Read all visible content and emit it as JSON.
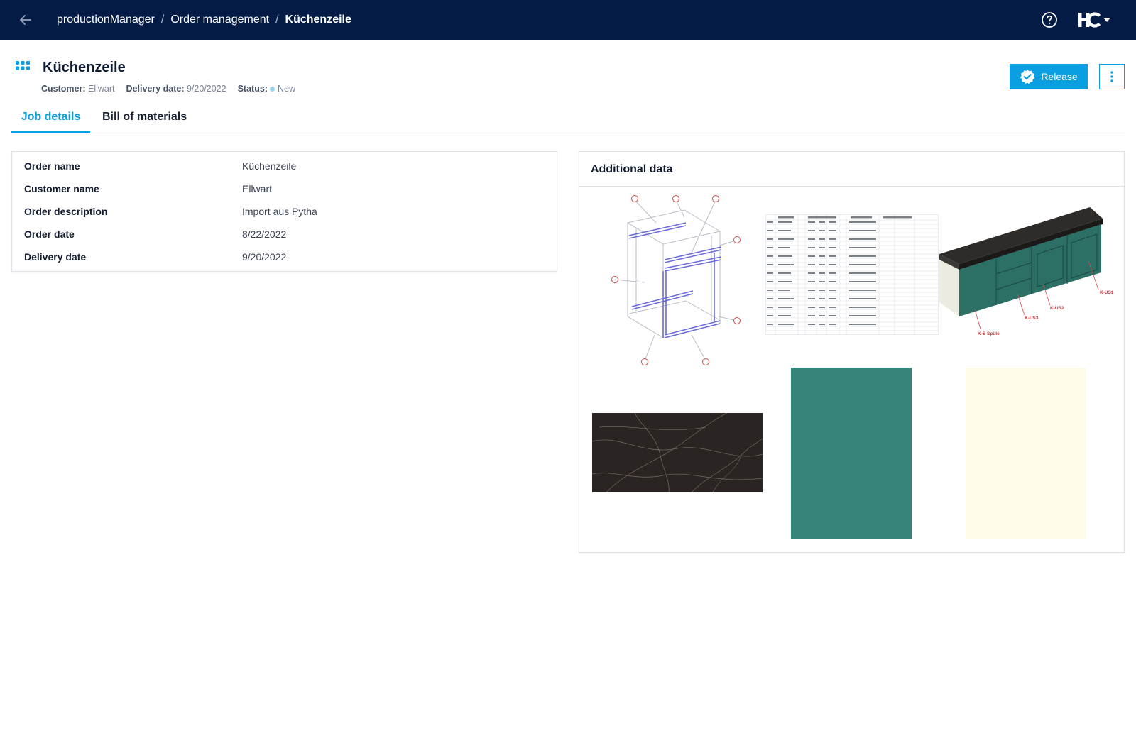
{
  "topbar": {
    "breadcrumbs": [
      "productionManager",
      "Order management",
      "Küchenzeile"
    ],
    "brand_logo_text": "HC"
  },
  "job": {
    "title": "Küchenzeile",
    "customer_label": "Customer:",
    "customer_value": "Ellwart",
    "delivery_label": "Delivery date:",
    "delivery_value": "9/20/2022",
    "status_label": "Status:",
    "status_value": "New",
    "status_color": "#9ad3ea"
  },
  "actions": {
    "release_label": "Release"
  },
  "tabs": [
    {
      "label": "Job details",
      "active": true
    },
    {
      "label": "Bill of materials",
      "active": false
    }
  ],
  "details": [
    {
      "label": "Order name",
      "value": "Küchenzeile"
    },
    {
      "label": "Customer name",
      "value": "Ellwart"
    },
    {
      "label": "Order description",
      "value": "Import aus Pytha"
    },
    {
      "label": "Order date",
      "value": "8/22/2022"
    },
    {
      "label": "Delivery date",
      "value": "9/20/2022"
    }
  ],
  "additional": {
    "title": "Additional data",
    "cabinet_labels": [
      "K-US1",
      "K-US2",
      "K-US3",
      "K-S Spüle"
    ],
    "swatch_colors": {
      "marble": "#2a2523",
      "green": "#35857a",
      "cream": "#fffbeb"
    }
  },
  "colors": {
    "topbar": "#031b45",
    "accent": "#0a9fe0"
  }
}
